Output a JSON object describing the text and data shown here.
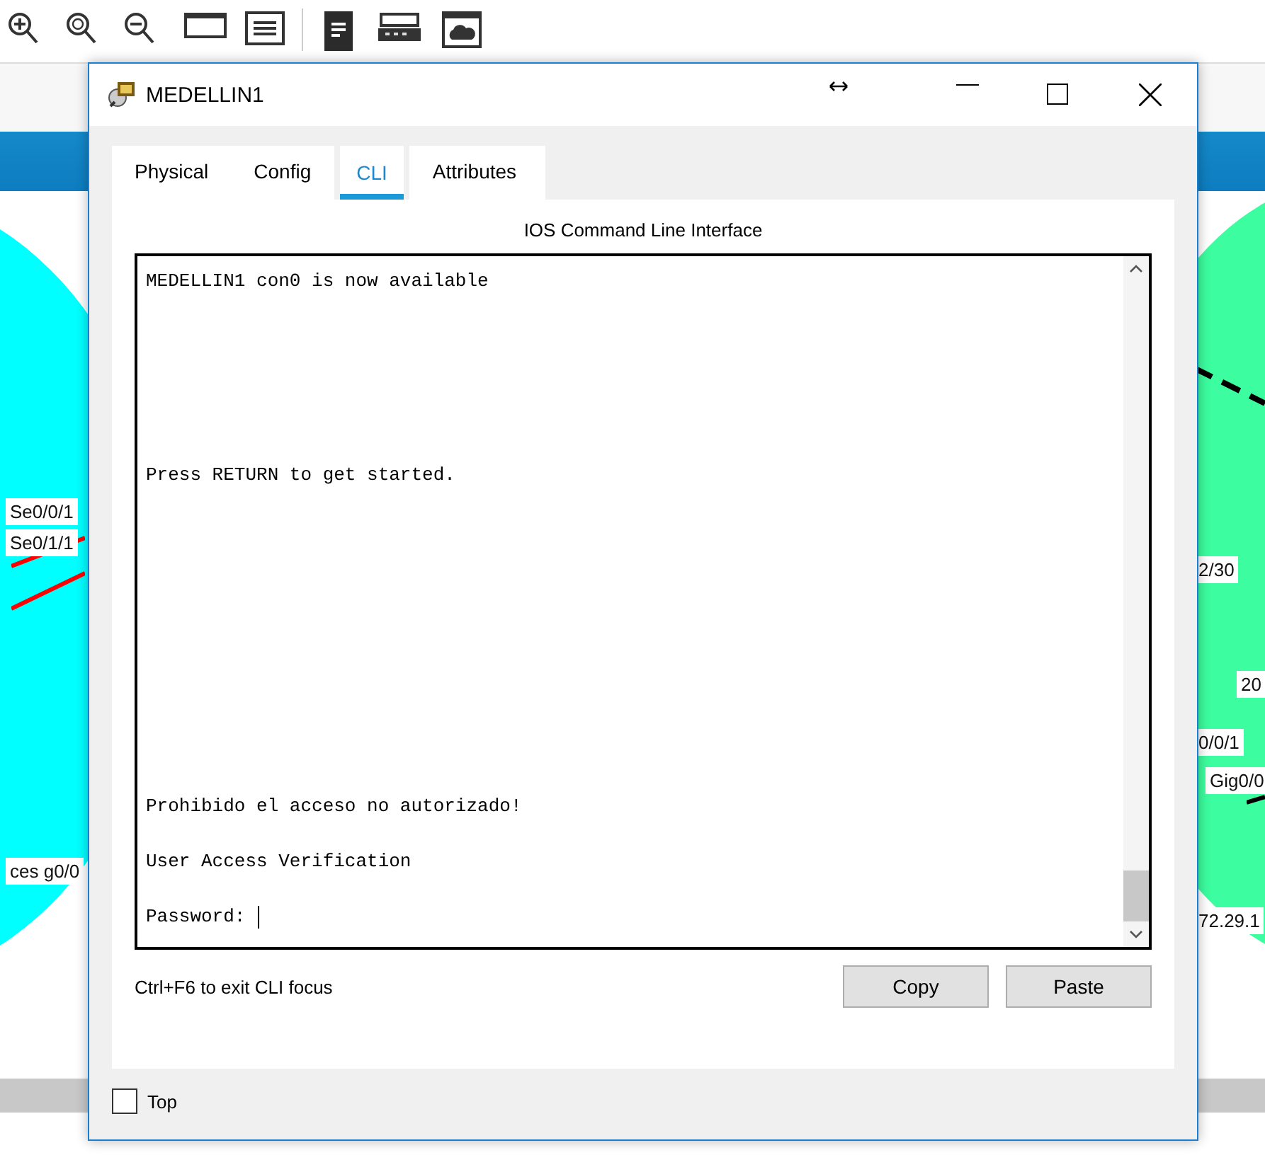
{
  "canvas_labels": [
    {
      "text": "Se0/0/1"
    },
    {
      "text": "Se0/1/1"
    },
    {
      "text": "ces g0/0"
    },
    {
      "text": "2/30"
    },
    {
      "text": "20"
    },
    {
      "text": "0/0/1"
    },
    {
      "text": "Gig0/0"
    },
    {
      "text": "72.29.1"
    }
  ],
  "window": {
    "title": "MEDELLIN1"
  },
  "tabs": [
    {
      "label": "Physical",
      "selected": false
    },
    {
      "label": "Config",
      "selected": false
    },
    {
      "label": "CLI",
      "selected": true
    },
    {
      "label": "Attributes",
      "selected": false
    }
  ],
  "cli": {
    "heading": "IOS Command Line Interface",
    "lines": [
      "MEDELLIN1 con0 is now available",
      "Press RETURN to get started.",
      "Prohibido el acceso no autorizado!",
      "User Access Verification",
      "Password: "
    ],
    "scrollbar": {
      "level": 0.08
    }
  },
  "hint": "Ctrl+F6 to exit CLI focus",
  "buttons": [
    "Copy",
    "Paste"
  ],
  "top_checkbox": {
    "label": "Top",
    "checked": false
  }
}
